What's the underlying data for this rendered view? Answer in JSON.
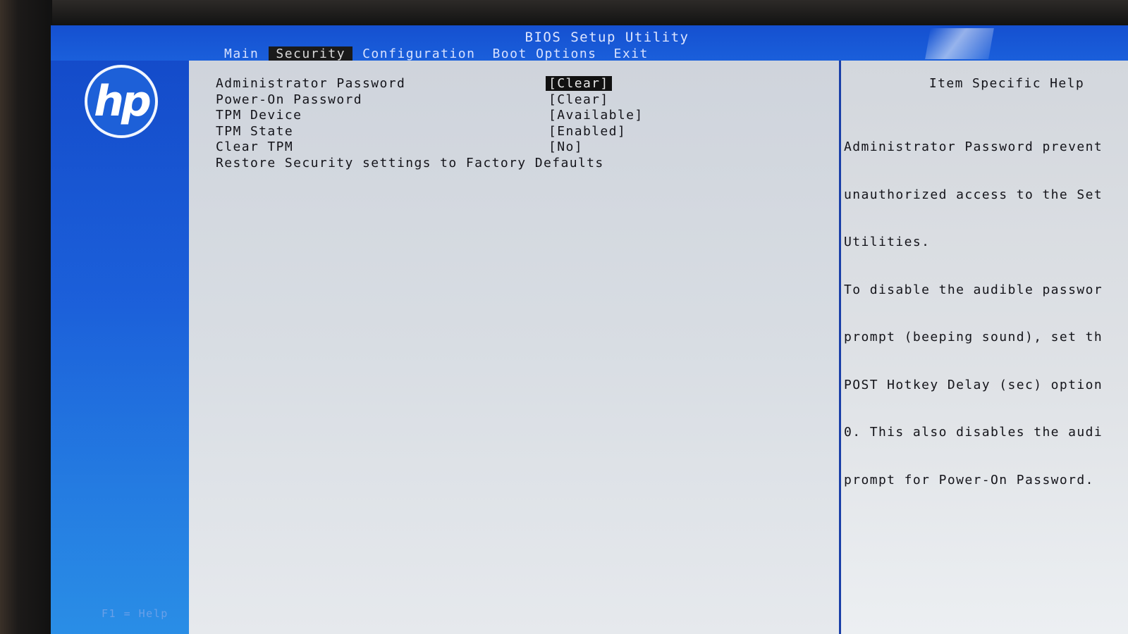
{
  "window": {
    "title": "BIOS Setup Utility"
  },
  "menu": {
    "tabs": [
      {
        "label": "Main"
      },
      {
        "label": "Security",
        "active": true
      },
      {
        "label": "Configuration"
      },
      {
        "label": "Boot Options"
      },
      {
        "label": "Exit"
      }
    ]
  },
  "logo": {
    "text": "hp",
    "icon": "hp-logo-icon"
  },
  "settings": {
    "items": [
      {
        "label": "Administrator Password",
        "value": "[Clear]",
        "selected": true
      },
      {
        "label": "Power-On Password",
        "value": "[Clear]"
      },
      {
        "label": "TPM Device",
        "value": "[Available]"
      },
      {
        "label": "TPM State",
        "value": "[Enabled]"
      },
      {
        "label": "Clear TPM",
        "value": "[No]"
      },
      {
        "label": "Restore Security settings to Factory Defaults",
        "value": ""
      }
    ]
  },
  "help": {
    "title": "Item Specific Help",
    "lines": [
      "Administrator Password prevent",
      "unauthorized access to the Set",
      "Utilities.",
      "To disable the audible passwor",
      "prompt (beeping sound), set th",
      "POST Hotkey Delay (sec) option",
      "0. This also disables the audi",
      "prompt for Power-On Password."
    ]
  },
  "footer": {
    "hint": "F1 = Help"
  },
  "colors": {
    "accent_blue": "#1a5ad8",
    "panel_bg": "#d8dde3",
    "selection_bg": "#111111"
  }
}
